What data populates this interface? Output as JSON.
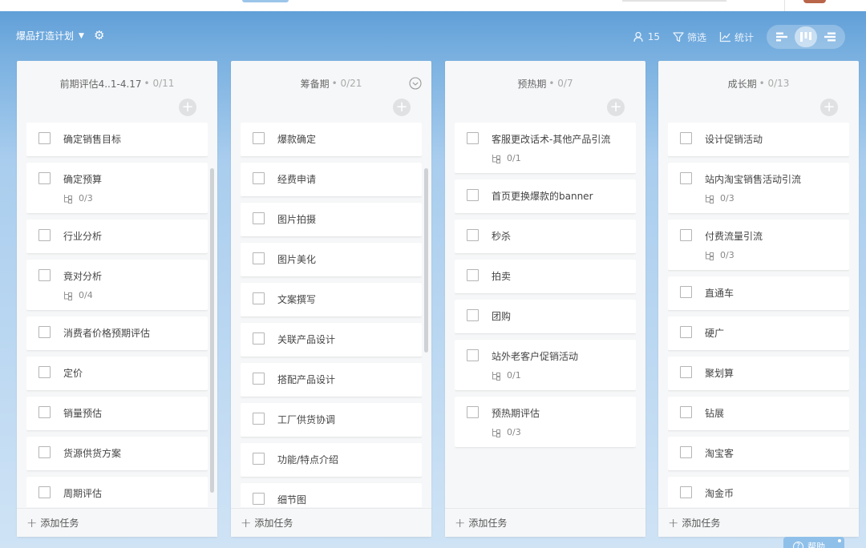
{
  "toolbar": {
    "project_name": "爆品打造计划",
    "member_count": "15",
    "filter_label": "筛选",
    "stats_label": "统计"
  },
  "columns": [
    {
      "title": "前期评估4..1-4.17",
      "count": "• 0/11",
      "cards": [
        {
          "title": "确定销售目标",
          "sub": ""
        },
        {
          "title": "确定预算",
          "sub": "0/3"
        },
        {
          "title": "行业分析",
          "sub": ""
        },
        {
          "title": "竟对分析",
          "sub": "0/4"
        },
        {
          "title": "消费者价格预期评估",
          "sub": ""
        },
        {
          "title": "定价",
          "sub": ""
        },
        {
          "title": "销量预估",
          "sub": ""
        },
        {
          "title": "货源供货方案",
          "sub": ""
        },
        {
          "title": "周期评估",
          "sub": ""
        }
      ],
      "add_label": "添加任务"
    },
    {
      "title": "筹备期",
      "count": "• 0/21",
      "cards": [
        {
          "title": "爆款确定",
          "sub": ""
        },
        {
          "title": "经费申请",
          "sub": ""
        },
        {
          "title": "图片拍摄",
          "sub": ""
        },
        {
          "title": "图片美化",
          "sub": ""
        },
        {
          "title": "文案撰写",
          "sub": ""
        },
        {
          "title": "关联产品设计",
          "sub": ""
        },
        {
          "title": "搭配产品设计",
          "sub": ""
        },
        {
          "title": "工厂供货协调",
          "sub": ""
        },
        {
          "title": "功能/特点介绍",
          "sub": ""
        },
        {
          "title": "细节图",
          "sub": ""
        }
      ],
      "add_label": "添加任务"
    },
    {
      "title": "预热期",
      "count": "• 0/7",
      "cards": [
        {
          "title": "客服更改话术-其他产品引流",
          "sub": "0/1"
        },
        {
          "title": "首页更换爆款的banner",
          "sub": ""
        },
        {
          "title": "秒杀",
          "sub": ""
        },
        {
          "title": "拍卖",
          "sub": ""
        },
        {
          "title": "团购",
          "sub": ""
        },
        {
          "title": "站外老客户促销活动",
          "sub": "0/1"
        },
        {
          "title": "预热期评估",
          "sub": "0/3"
        }
      ],
      "add_label": "添加任务"
    },
    {
      "title": "成长期",
      "count": "• 0/13",
      "cards": [
        {
          "title": "设计促销活动",
          "sub": ""
        },
        {
          "title": "站内淘宝销售活动引流",
          "sub": "0/3"
        },
        {
          "title": "付费流量引流",
          "sub": "0/3"
        },
        {
          "title": "直通车",
          "sub": ""
        },
        {
          "title": "硬广",
          "sub": ""
        },
        {
          "title": "聚划算",
          "sub": ""
        },
        {
          "title": "钻展",
          "sub": ""
        },
        {
          "title": "淘宝客",
          "sub": ""
        },
        {
          "title": "淘金币",
          "sub": ""
        }
      ],
      "add_label": "添加任务"
    }
  ],
  "help": {
    "label": "帮助"
  },
  "colors": {
    "accent": "#5b9bd6",
    "column_bg": "#f6f7f8",
    "card_bg": "#ffffff"
  },
  "icons": {
    "gear": "gear-icon",
    "members": "person-icon",
    "filter": "funnel-icon",
    "stats": "line-chart-icon",
    "subtask": "subtask-tree-icon"
  }
}
